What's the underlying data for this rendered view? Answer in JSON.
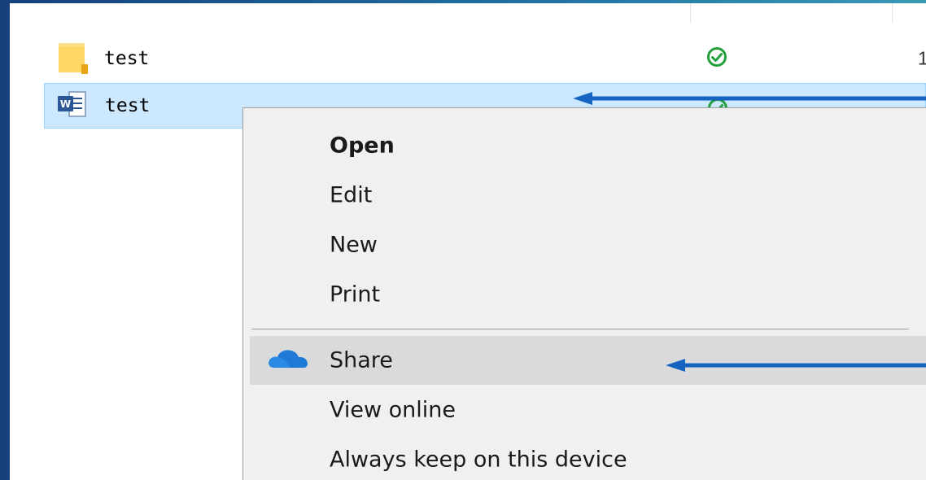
{
  "files": [
    {
      "name": "test",
      "icon": "folder-icon",
      "status": "synced",
      "extra": "1",
      "selected": false
    },
    {
      "name": "test",
      "icon": "word-document-icon",
      "status": "synced",
      "extra": "",
      "selected": true
    }
  ],
  "context_menu": {
    "items": [
      {
        "label": "Open",
        "bold": true
      },
      {
        "label": "Edit"
      },
      {
        "label": "New"
      },
      {
        "label": "Print"
      },
      {
        "label": "Share",
        "icon": "onedrive-cloud-icon",
        "highlighted": true
      },
      {
        "label": "View online"
      },
      {
        "label": "Always keep on this device"
      }
    ]
  },
  "colors": {
    "selection_bg": "#cce8ff",
    "selection_border": "#99d1ff",
    "menu_bg": "#f0f0f0",
    "menu_hover": "#dadada",
    "annotation_arrow": "#1565c0",
    "sync_green": "#21a03a",
    "folder_yellow": "#ffd766",
    "word_blue": "#2b5797",
    "onedrive_blue": "#1e7ad6"
  }
}
